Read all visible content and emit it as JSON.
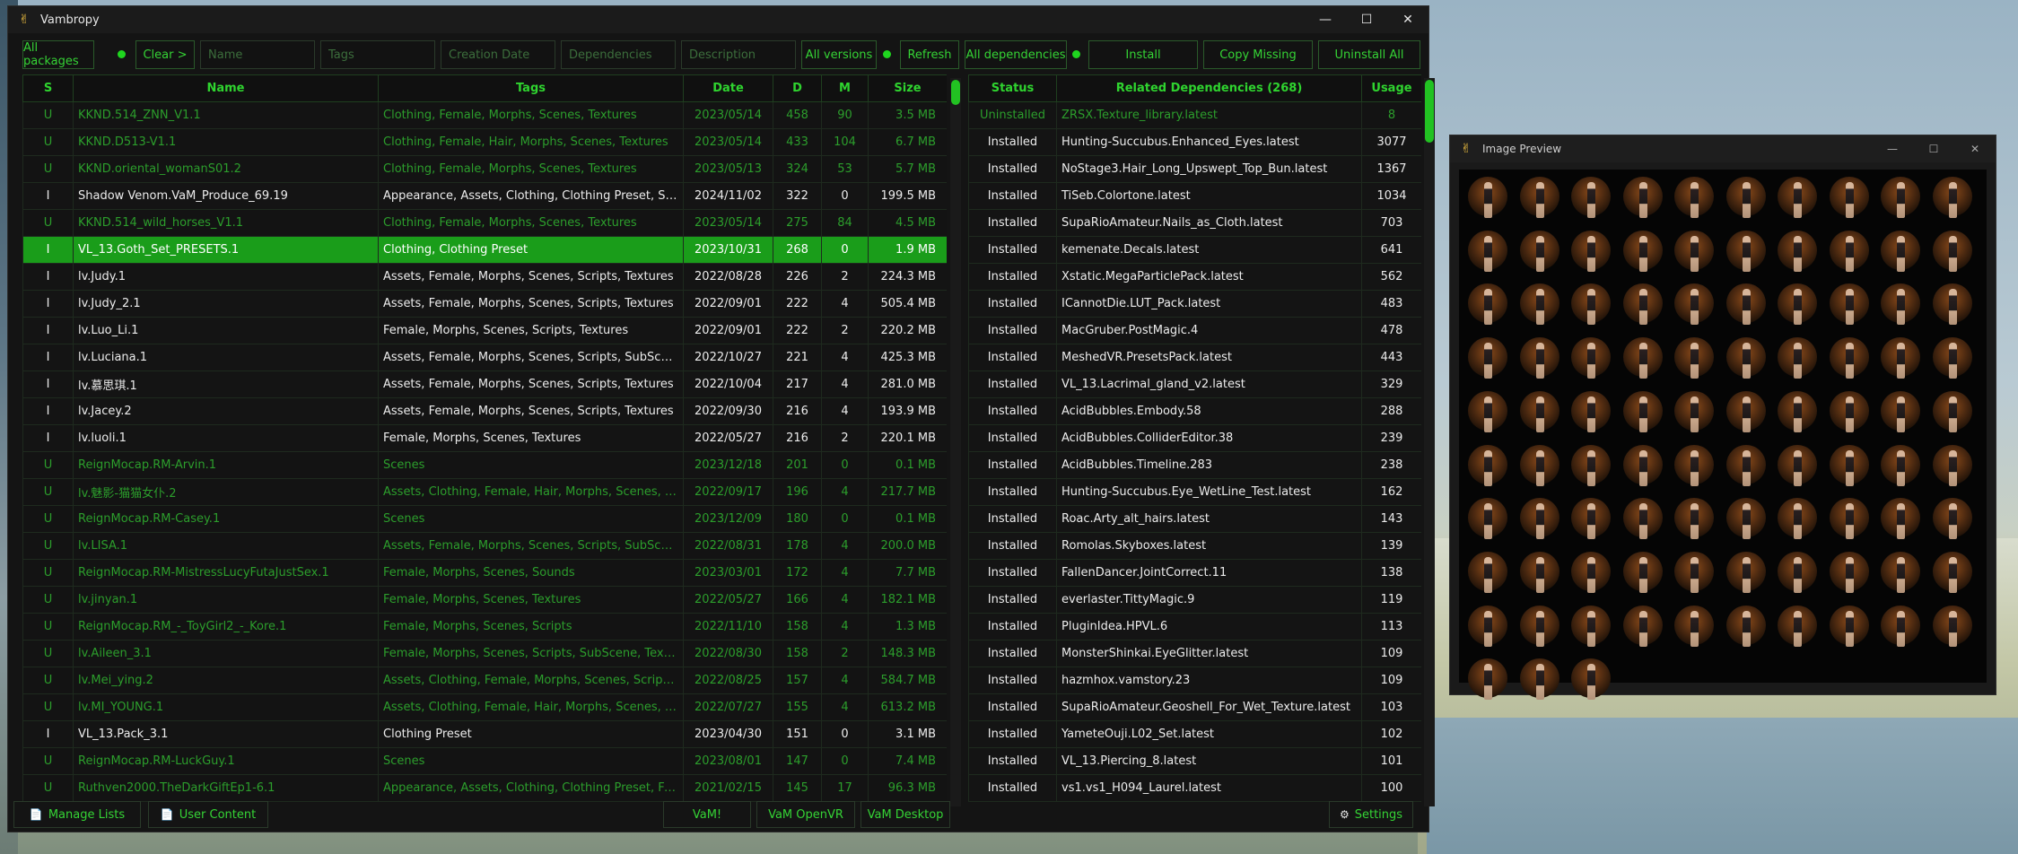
{
  "app": {
    "title": "Vambropy",
    "window_controls": {
      "minimize": "—",
      "maximize": "☐",
      "close": "✕"
    }
  },
  "toolbar": {
    "all_packages": "All packages",
    "clear": "Clear >",
    "name_ph": "Name",
    "tags_ph": "Tags",
    "date_ph": "Creation Date",
    "deps_ph": "Dependencies",
    "desc_ph": "Description",
    "all_versions": "All versions",
    "refresh": "Refresh",
    "all_deps": "All dependencies",
    "install": "Install",
    "copy_missing": "Copy Missing",
    "uninstall_all": "Uninstall All",
    "accent": "#1fd61f"
  },
  "packages": {
    "headers": [
      "S",
      "Name",
      "Tags",
      "Date",
      "D",
      "M",
      "Size"
    ],
    "rows": [
      {
        "s": "U",
        "name": "KKND.514_ZNN_V1.1",
        "tags": "Clothing, Female, Morphs, Scenes, Textures",
        "date": "2023/05/14",
        "d": "458",
        "m": "90",
        "size": "3.5 MB"
      },
      {
        "s": "U",
        "name": "KKND.D513-V1.1",
        "tags": "Clothing, Female, Hair, Morphs, Scenes, Textures",
        "date": "2023/05/14",
        "d": "433",
        "m": "104",
        "size": "6.7 MB"
      },
      {
        "s": "U",
        "name": "KKND.oriental_womanS01.2",
        "tags": "Clothing, Female, Morphs, Scenes, Textures",
        "date": "2023/05/13",
        "d": "324",
        "m": "53",
        "size": "5.7 MB"
      },
      {
        "s": "I",
        "name": "Shadow Venom.VaM_Produce_69.19",
        "tags": "Appearance, Assets, Clothing, Clothing Preset, Scenes, ...",
        "date": "2024/11/02",
        "d": "322",
        "m": "0",
        "size": "199.5 MB"
      },
      {
        "s": "U",
        "name": "KKND.514_wild_horses_V1.1",
        "tags": "Clothing, Female, Morphs, Scenes, Textures",
        "date": "2023/05/14",
        "d": "275",
        "m": "84",
        "size": "4.5 MB"
      },
      {
        "s": "I",
        "name": "VL_13.Goth_Set_PRESETS.1",
        "tags": "Clothing, Clothing Preset",
        "date": "2023/10/31",
        "d": "268",
        "m": "0",
        "size": "1.9 MB",
        "sel": true
      },
      {
        "s": "I",
        "name": "lv.Judy.1",
        "tags": "Assets, Female, Morphs, Scenes, Scripts, Textures",
        "date": "2022/08/28",
        "d": "226",
        "m": "2",
        "size": "224.3 MB"
      },
      {
        "s": "I",
        "name": "lv.Judy_2.1",
        "tags": "Assets, Female, Morphs, Scenes, Scripts, Textures",
        "date": "2022/09/01",
        "d": "222",
        "m": "4",
        "size": "505.4 MB"
      },
      {
        "s": "I",
        "name": "lv.Luo_Li.1",
        "tags": "Female, Morphs, Scenes, Scripts, Textures",
        "date": "2022/09/01",
        "d": "222",
        "m": "2",
        "size": "220.2 MB"
      },
      {
        "s": "I",
        "name": "lv.Luciana.1",
        "tags": "Assets, Female, Morphs, Scenes, Scripts, SubScene, ...",
        "date": "2022/10/27",
        "d": "221",
        "m": "4",
        "size": "425.3 MB"
      },
      {
        "s": "I",
        "name": "lv.慕思琪.1",
        "tags": "Assets, Female, Morphs, Scenes, Scripts, Textures",
        "date": "2022/10/04",
        "d": "217",
        "m": "4",
        "size": "281.0 MB"
      },
      {
        "s": "I",
        "name": "lv.Jacey.2",
        "tags": "Assets, Female, Morphs, Scenes, Scripts, Textures",
        "date": "2022/09/30",
        "d": "216",
        "m": "4",
        "size": "193.9 MB"
      },
      {
        "s": "I",
        "name": "lv.luoli.1",
        "tags": "Female, Morphs, Scenes, Textures",
        "date": "2022/05/27",
        "d": "216",
        "m": "2",
        "size": "220.1 MB"
      },
      {
        "s": "U",
        "name": "ReignMocap.RM-Arvin.1",
        "tags": "Scenes",
        "date": "2023/12/18",
        "d": "201",
        "m": "0",
        "size": "0.1 MB"
      },
      {
        "s": "U",
        "name": "lv.魅影-猫猫女仆.2",
        "tags": "Assets, Clothing, Female, Hair, Morphs, Scenes, Scripts,...",
        "date": "2022/09/17",
        "d": "196",
        "m": "4",
        "size": "217.7 MB"
      },
      {
        "s": "U",
        "name": "ReignMocap.RM-Casey.1",
        "tags": "Scenes",
        "date": "2023/12/09",
        "d": "180",
        "m": "0",
        "size": "0.1 MB"
      },
      {
        "s": "U",
        "name": "lv.LISA.1",
        "tags": "Assets, Female, Morphs, Scenes, Scripts, SubScene, ...",
        "date": "2022/08/31",
        "d": "178",
        "m": "4",
        "size": "200.0 MB"
      },
      {
        "s": "U",
        "name": "ReignMocap.RM-MistressLucyFutaJustSex.1",
        "tags": "Female, Morphs, Scenes, Sounds",
        "date": "2023/03/01",
        "d": "172",
        "m": "4",
        "size": "7.7 MB"
      },
      {
        "s": "U",
        "name": "lv.jinyan.1",
        "tags": "Female, Morphs, Scenes, Textures",
        "date": "2022/05/27",
        "d": "166",
        "m": "4",
        "size": "182.1 MB"
      },
      {
        "s": "U",
        "name": "ReignMocap.RM_-_ToyGirl2_-_Kore.1",
        "tags": "Female, Morphs, Scenes, Scripts",
        "date": "2022/11/10",
        "d": "158",
        "m": "4",
        "size": "1.3 MB"
      },
      {
        "s": "U",
        "name": "lv.Aileen_3.1",
        "tags": "Female, Morphs, Scenes, Scripts, SubScene, Textures",
        "date": "2022/08/30",
        "d": "158",
        "m": "2",
        "size": "148.3 MB"
      },
      {
        "s": "U",
        "name": "lv.Mei_ying.2",
        "tags": "Assets, Clothing, Female, Morphs, Scenes, Scripts, ...",
        "date": "2022/08/25",
        "d": "157",
        "m": "4",
        "size": "584.7 MB"
      },
      {
        "s": "U",
        "name": "lv.MI_YOUNG.1",
        "tags": "Assets, Clothing, Female, Hair, Morphs, Scenes, Scripts,...",
        "date": "2022/07/27",
        "d": "155",
        "m": "4",
        "size": "613.2 MB"
      },
      {
        "s": "I",
        "name": "VL_13.Pack_3.1",
        "tags": "Clothing Preset",
        "date": "2023/04/30",
        "d": "151",
        "m": "0",
        "size": "3.1 MB"
      },
      {
        "s": "U",
        "name": "ReignMocap.RM-LuckGuy.1",
        "tags": "Scenes",
        "date": "2023/08/01",
        "d": "147",
        "m": "0",
        "size": "7.4 MB"
      },
      {
        "s": "U",
        "name": "Ruthven2000.TheDarkGiftEp1-6.1",
        "tags": "Appearance, Assets, Clothing, Clothing Preset, Female, ...",
        "date": "2021/02/15",
        "d": "145",
        "m": "17",
        "size": "96.3 MB"
      }
    ]
  },
  "dependencies": {
    "headers": [
      "Status",
      "Related Dependencies (268)",
      "Usage"
    ],
    "rows": [
      {
        "status": "Uninstalled",
        "name": "ZRSX.Texture_library.latest",
        "usage": "8"
      },
      {
        "status": "Installed",
        "name": "Hunting-Succubus.Enhanced_Eyes.latest",
        "usage": "3077"
      },
      {
        "status": "Installed",
        "name": "NoStage3.Hair_Long_Upswept_Top_Bun.latest",
        "usage": "1367"
      },
      {
        "status": "Installed",
        "name": "TiSeb.Colortone.latest",
        "usage": "1034"
      },
      {
        "status": "Installed",
        "name": "SupaRioAmateur.Nails_as_Cloth.latest",
        "usage": "703"
      },
      {
        "status": "Installed",
        "name": "kemenate.Decals.latest",
        "usage": "641"
      },
      {
        "status": "Installed",
        "name": "Xstatic.MegaParticlePack.latest",
        "usage": "562"
      },
      {
        "status": "Installed",
        "name": "ICannotDie.LUT_Pack.latest",
        "usage": "483"
      },
      {
        "status": "Installed",
        "name": "MacGruber.PostMagic.4",
        "usage": "478"
      },
      {
        "status": "Installed",
        "name": "MeshedVR.PresetsPack.latest",
        "usage": "443"
      },
      {
        "status": "Installed",
        "name": "VL_13.Lacrimal_gland_v2.latest",
        "usage": "329"
      },
      {
        "status": "Installed",
        "name": "AcidBubbles.Embody.58",
        "usage": "288"
      },
      {
        "status": "Installed",
        "name": "AcidBubbles.ColliderEditor.38",
        "usage": "239"
      },
      {
        "status": "Installed",
        "name": "AcidBubbles.Timeline.283",
        "usage": "238"
      },
      {
        "status": "Installed",
        "name": "Hunting-Succubus.Eye_WetLine_Test.latest",
        "usage": "162"
      },
      {
        "status": "Installed",
        "name": "Roac.Arty_alt_hairs.latest",
        "usage": "143"
      },
      {
        "status": "Installed",
        "name": "Romolas.Skyboxes.latest",
        "usage": "139"
      },
      {
        "status": "Installed",
        "name": "FallenDancer.JointCorrect.11",
        "usage": "138"
      },
      {
        "status": "Installed",
        "name": "everlaster.TittyMagic.9",
        "usage": "119"
      },
      {
        "status": "Installed",
        "name": "PluginIdea.HPVL.6",
        "usage": "113"
      },
      {
        "status": "Installed",
        "name": "MonsterShinkai.EyeGlitter.latest",
        "usage": "109"
      },
      {
        "status": "Installed",
        "name": "hazmhox.vamstory.23",
        "usage": "109"
      },
      {
        "status": "Installed",
        "name": "SupaRioAmateur.Geoshell_For_Wet_Texture.latest",
        "usage": "103"
      },
      {
        "status": "Installed",
        "name": "YameteOuji.L02_Set.latest",
        "usage": "102"
      },
      {
        "status": "Installed",
        "name": "VL_13.Piercing_8.latest",
        "usage": "101"
      },
      {
        "status": "Installed",
        "name": "vs1.vs1_H094_Laurel.latest",
        "usage": "100"
      }
    ]
  },
  "bottom": {
    "manage_lists": "Manage Lists",
    "user_content": "User Content",
    "vam": "VaM!",
    "vam_openvr": "VaM OpenVR",
    "vam_desktop": "VaM Desktop",
    "settings": "Settings"
  },
  "preview": {
    "title": "Image Preview",
    "thumbnail_count": 93
  }
}
